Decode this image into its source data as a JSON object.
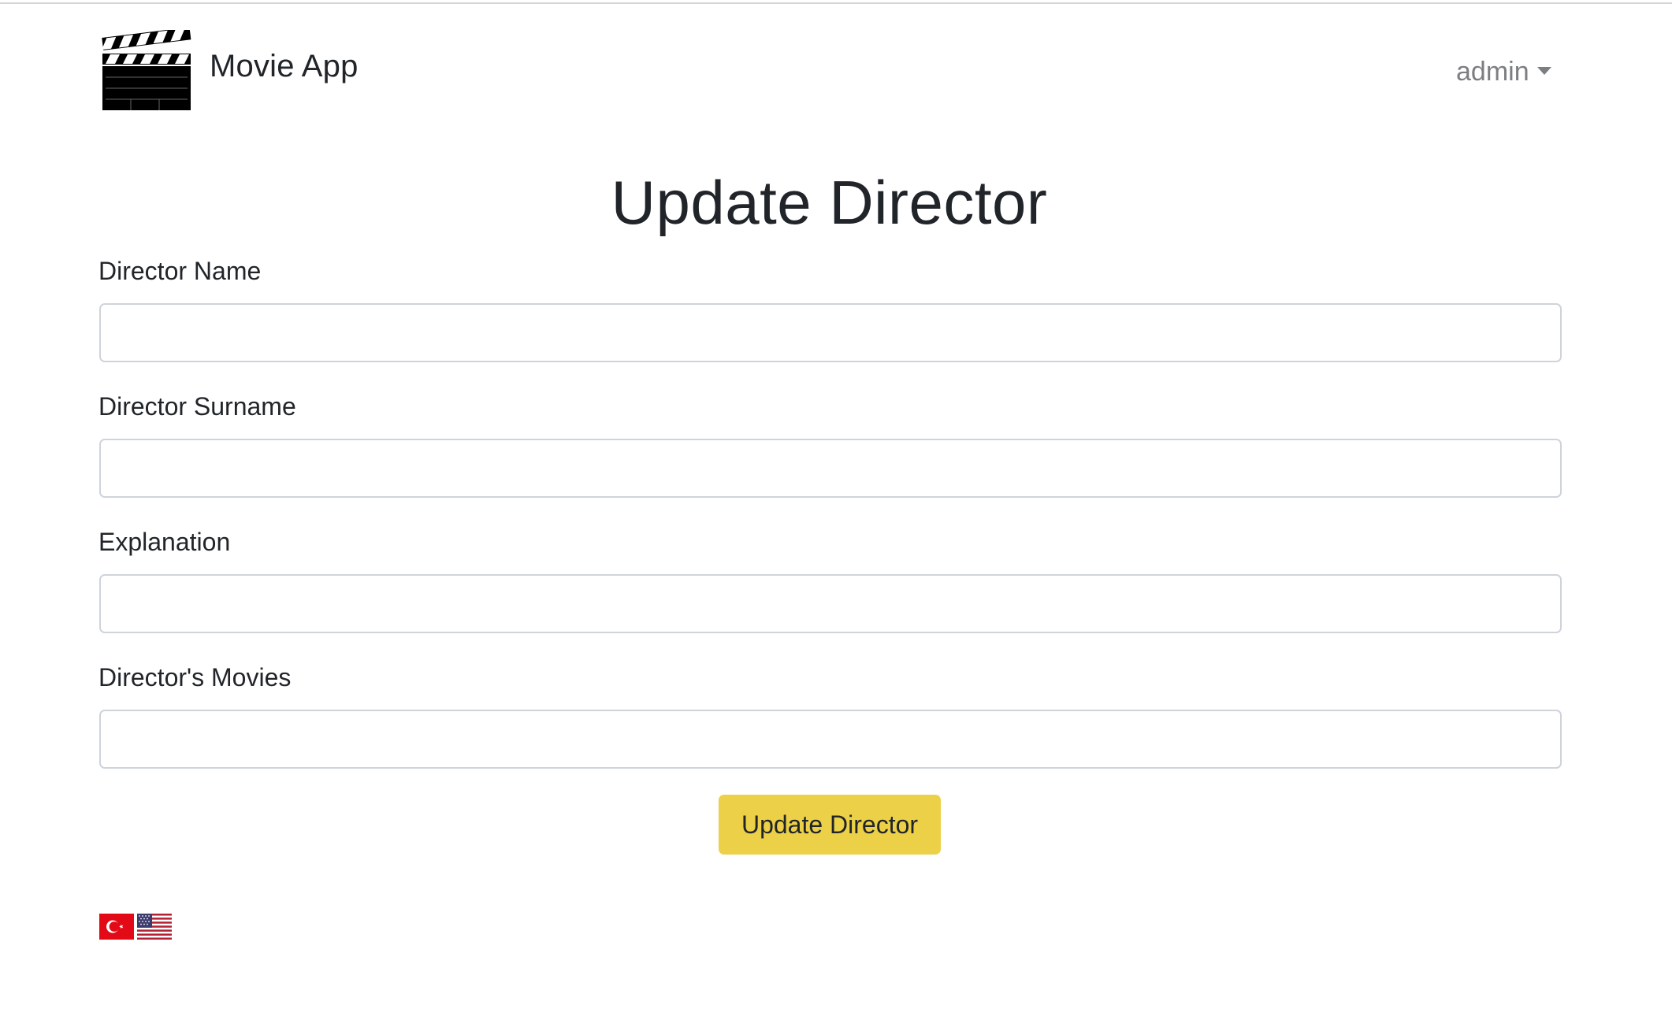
{
  "header": {
    "brand_name": "Movie App",
    "logo_icon": "clapperboard-icon",
    "user_menu_label": "admin"
  },
  "page": {
    "title": "Update Director"
  },
  "form": {
    "fields": [
      {
        "label": "Director Name",
        "value": "",
        "placeholder": ""
      },
      {
        "label": "Director Surname",
        "value": "",
        "placeholder": ""
      },
      {
        "label": "Explanation",
        "value": "",
        "placeholder": ""
      },
      {
        "label": "Director's Movies",
        "value": "",
        "placeholder": ""
      }
    ],
    "submit_label": "Update Director",
    "submit_color": "#ecd047"
  },
  "languages": [
    {
      "icon": "turkey-flag-icon",
      "color": "#e30a17"
    },
    {
      "icon": "us-flag-icon",
      "color": "#3c3b6e"
    }
  ]
}
